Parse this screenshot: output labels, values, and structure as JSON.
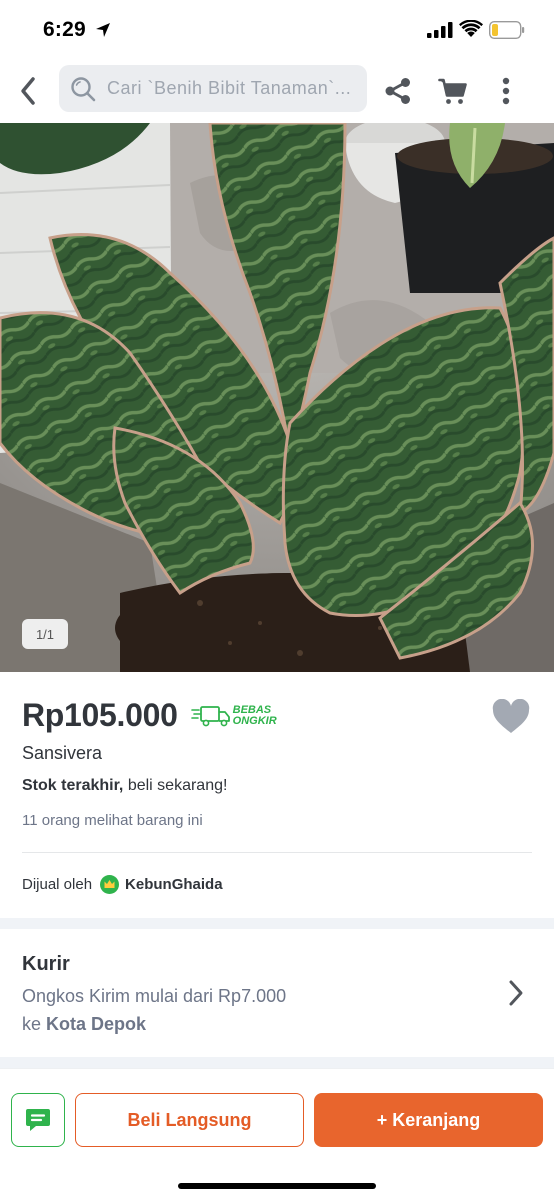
{
  "status_bar": {
    "time": "6:29",
    "icons": [
      "location-arrow-icon",
      "signal-icon",
      "wifi-icon",
      "battery-icon"
    ]
  },
  "top_nav": {
    "search_placeholder": "Cari `Benih Bibit Tanaman`...",
    "icons": [
      "back-arrow-icon",
      "search-icon",
      "share-icon",
      "cart-icon",
      "more-vertical-icon"
    ]
  },
  "product": {
    "image_counter": "1/1",
    "price": "Rp105.000",
    "free_shipping_line1": "BEBAS",
    "free_shipping_line2": "ONGKIR",
    "name": "Sansivera",
    "stock_bold": "Stok terakhir,",
    "stock_rest": " beli sekarang!",
    "viewers": "11 orang melihat barang ini"
  },
  "seller": {
    "prefix": "Dijual oleh",
    "name": "KebunGhaida"
  },
  "courier": {
    "title": "Kurir",
    "line1": "Ongkos Kirim mulai dari Rp7.000",
    "line2_prefix": "ke ",
    "line2_city": "Kota Depok"
  },
  "actions": {
    "buy_now": "Beli Langsung",
    "add_to_cart": "+ Keranjang"
  },
  "colors": {
    "primary_orange": "#e8652d",
    "green_accent": "#2fb34c",
    "text_dark": "#31353b",
    "text_muted": "#6d7588"
  }
}
